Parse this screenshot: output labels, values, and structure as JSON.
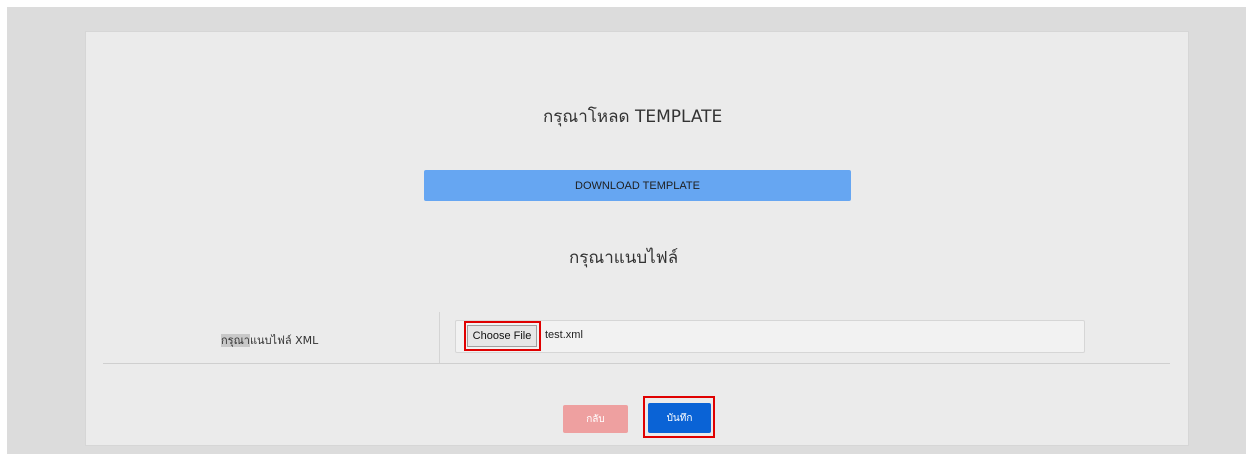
{
  "page": {
    "template_heading": "กรุณาโหลด TEMPLATE",
    "download_button_label": "DOWNLOAD TEMPLATE",
    "attach_heading": "กรุณาแนบไฟล์"
  },
  "form": {
    "field_label_highlight": "กรุณา",
    "field_label_rest": "แนบไฟล์ XML",
    "choose_file_label": "Choose File",
    "selected_file": "test.xml"
  },
  "actions": {
    "back_label": "กลับ",
    "save_label": "บันทึก"
  },
  "colors": {
    "download_button": "#66a6f2",
    "back_button": "#eea0a0",
    "save_button": "#0a63d6",
    "annotation_outline": "#e00000"
  }
}
